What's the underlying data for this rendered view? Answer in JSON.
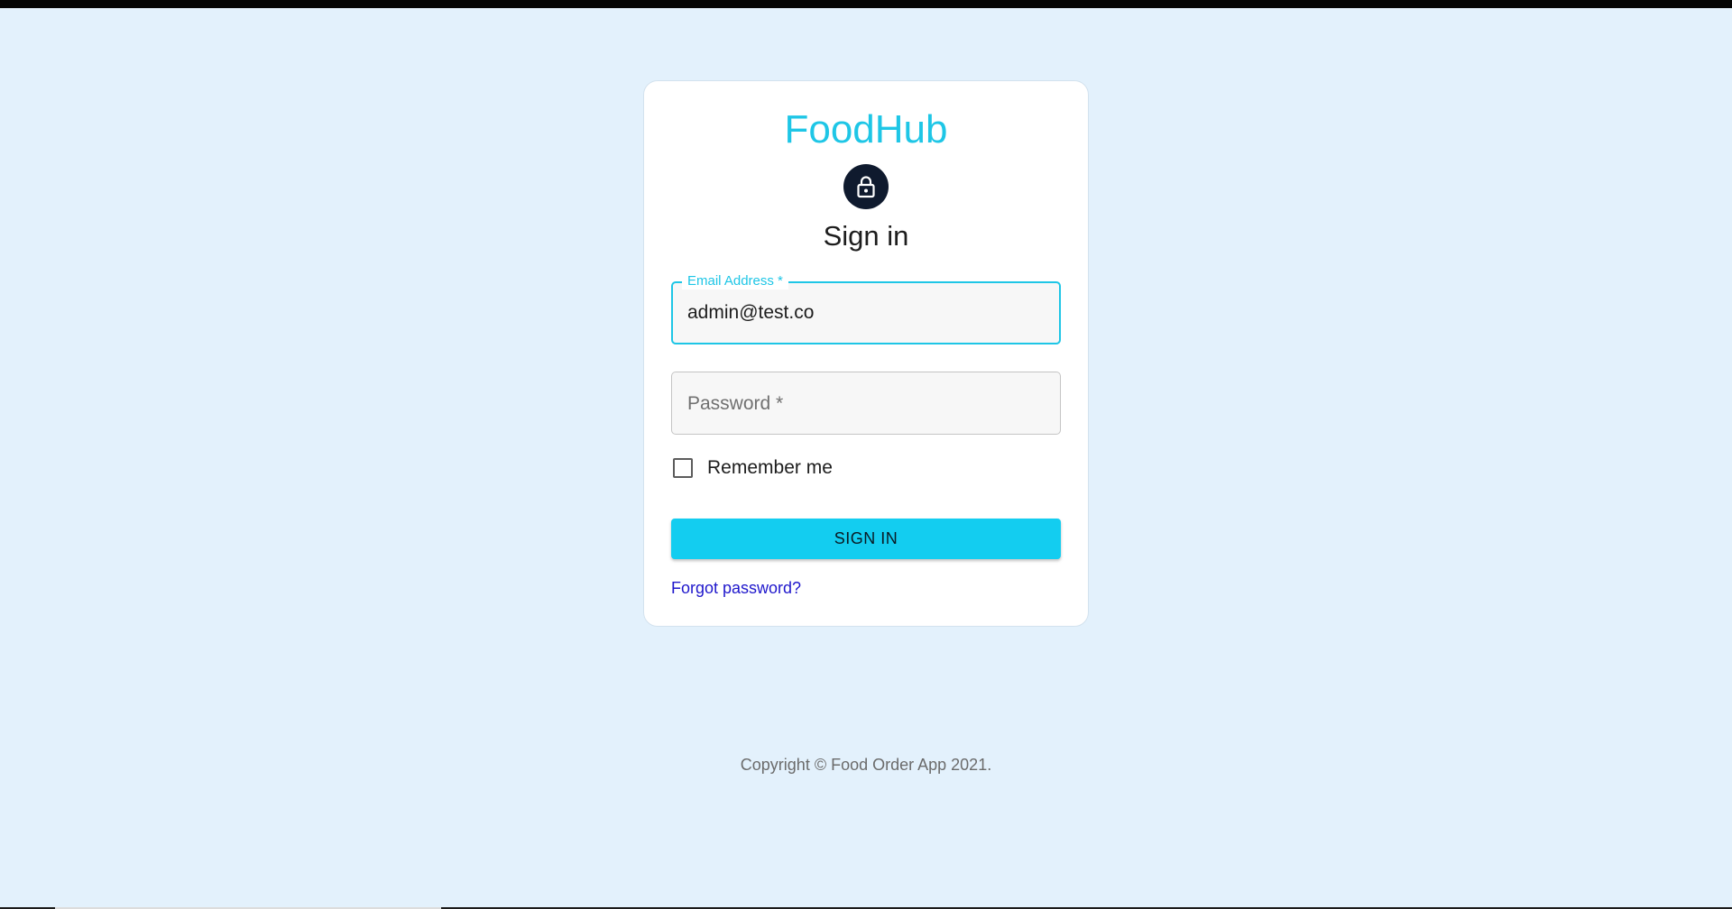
{
  "app": {
    "brand": "FoodHub"
  },
  "signin": {
    "heading": "Sign in",
    "email": {
      "label": "Email Address *",
      "value": "admin@test.co"
    },
    "password": {
      "placeholder": "Password *",
      "value": ""
    },
    "remember_me": {
      "label": "Remember me",
      "checked": false
    },
    "submit_label": "SIGN IN",
    "forgot_label": "Forgot password?"
  },
  "footer": {
    "copyright": "Copyright © Food Order App 2021."
  },
  "icons": {
    "avatar": "lock-icon"
  },
  "colors": {
    "accent": "#1ec6e6",
    "button": "#13cdf0",
    "avatar_bg": "#0f1a2e",
    "link": "#1f17cc",
    "page_bg": "#e3f1fc"
  }
}
